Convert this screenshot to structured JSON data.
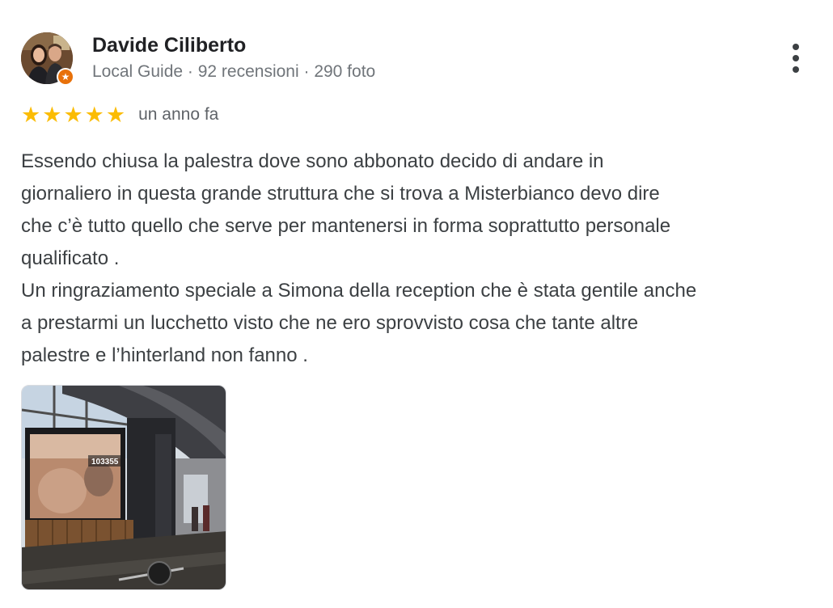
{
  "review": {
    "author": {
      "name": "Davide Ciliberto",
      "meta": "Local Guide · 92 recensioni · 290 foto",
      "avatar_icon": "user-avatar",
      "badge_icon": "local-guide-star-icon",
      "badge_glyph": "★"
    },
    "more_icon": "more-vert-icon",
    "rating": {
      "stars": 5,
      "max": 5,
      "star_glyph": "★",
      "star_color": "#fbbc04"
    },
    "date": "un anno fa",
    "text_lines": [
      "Essendo chiusa la palestra dove sono abbonato decido di andare in",
      "giornaliero in questa grande struttura che si trova a Misterbianco devo dire",
      "che c’è tutto quello che serve per mantenersi in forma soprattutto personale",
      "qualificato .",
      "Un ringraziamento speciale a Simona della reception che è stata gentile anche",
      "a prestarmi un lucchetto visto che ne ero sprovvisto cosa che tante altre",
      "palestre e l’hinterland non fanno ."
    ],
    "photo": {
      "screen_counter": "103355"
    }
  },
  "colors": {
    "author_name": "#202124",
    "meta": "#70757a",
    "body_text": "#3c4043",
    "badge": "#e8710a"
  }
}
